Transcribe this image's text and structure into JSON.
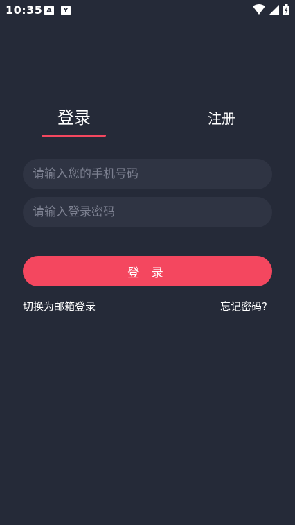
{
  "status_bar": {
    "time": "10:35",
    "app_icons": [
      "A",
      "Y"
    ],
    "right_icons": [
      "wifi-icon",
      "signal-icon",
      "battery-icon"
    ]
  },
  "tabs": {
    "login_label": "登录",
    "register_label": "注册",
    "active": "login"
  },
  "form": {
    "phone_placeholder": "请输入您的手机号码",
    "password_placeholder": "请输入登录密码",
    "submit_label": "登 录"
  },
  "links": {
    "switch_email": "切换为邮箱登录",
    "forgot_password": "忘记密码?"
  },
  "colors": {
    "background": "#252a38",
    "field_background": "#2f3443",
    "accent": "#f4475f"
  }
}
